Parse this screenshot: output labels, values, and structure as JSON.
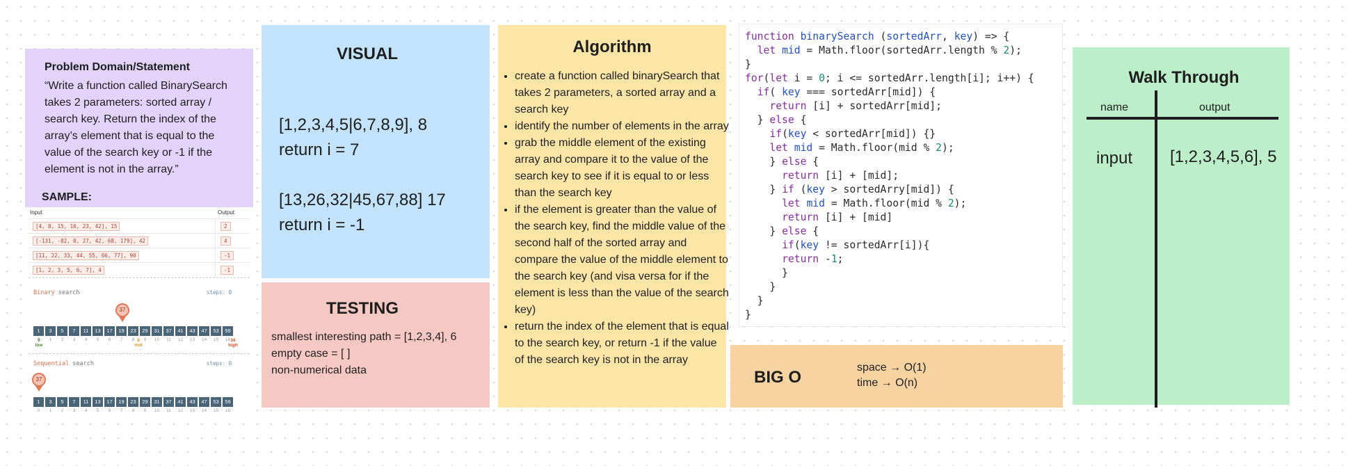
{
  "problem": {
    "title": "Problem Domain/Statement",
    "statement": "“Write a function called BinarySearch takes 2 parameters: sorted array / search key.  Return the index of the array’s element that is equal to the value of the search key or -1 if the element is not in the array.”",
    "sample_label": "SAMPLE:"
  },
  "sample": {
    "header_input": "Input",
    "header_output": "Output",
    "rows": [
      {
        "input": "[4, 8, 15, 16, 23, 42], 15",
        "output": "2"
      },
      {
        "input": "[-131, -82, 0, 27, 42, 68, 179], 42",
        "output": "4"
      },
      {
        "input": "[11, 22, 33, 44, 55, 66, 77], 90",
        "output": "-1"
      },
      {
        "input": "[1, 2, 3, 5, 6, 7], 4",
        "output": "-1"
      }
    ],
    "binary": {
      "title_highlight": "Binary",
      "title_rest": " search",
      "steps": "steps: 0",
      "pin": "37",
      "low": "low",
      "mid": "mid",
      "high": "high"
    },
    "sequential": {
      "title_highlight": "Sequential",
      "title_rest": " search",
      "steps": "steps: 0",
      "pin": "37"
    },
    "cells": [
      "1",
      "3",
      "5",
      "7",
      "11",
      "13",
      "17",
      "19",
      "23",
      "29",
      "31",
      "37",
      "41",
      "43",
      "47",
      "53",
      "59"
    ],
    "indices": [
      "0",
      "1",
      "2",
      "3",
      "4",
      "5",
      "6",
      "7",
      "8",
      "9",
      "10",
      "11",
      "12",
      "13",
      "14",
      "15",
      "16"
    ]
  },
  "visual": {
    "title": "VISUAL",
    "line1": "[1,2,3,4,5|6,7,8,9], 8",
    "line2": "return i = 7",
    "line3": "[13,26,32|45,67,88] 17",
    "line4": "return i = -1"
  },
  "testing": {
    "title": "TESTING",
    "line1": "smallest interesting path = [1,2,3,4], 6",
    "line2": "empty case = [ ]",
    "line3": "non-numerical data"
  },
  "algorithm": {
    "title": "Algorithm",
    "steps": [
      "create a function called binarySearch that takes 2 parameters, a sorted array and a search key",
      "identify the number of elements in the array",
      "grab the middle element of the existing array and compare it to the value of the search key to see if it is equal to or less than the search key",
      "if the element is greater than the value of the search key, find the middle value of the second half of the sorted array and compare the value of the middle element to the search key (and visa versa for if the element is less than the value of the search key)",
      "return the index of the element that is equal to the search key, or return -1 if the value of the search key is not in the array"
    ]
  },
  "code": {
    "lines": [
      "function binarySearch (sortedArr, key) => {",
      "  let mid = Math.floor(sortedArr.length % 2);",
      "}",
      "for(let i = 0; i <= sortedArr.length[i]; i++) {",
      "  if( key === sortedArr[mid]) {",
      "    return [i] + sortedArr[mid];",
      "  } else {",
      "    if(key < sortedArr[mid]) {}",
      "    let mid = Math.floor(mid % 2);",
      "    } else {",
      "      return [i] + [mid];",
      "    } if (key > sortedArry[mid]) {",
      "      let mid = Math.floor(mid % 2);",
      "      return [i] + [mid]",
      "    } else {",
      "      if(key != sortedArr[i]){",
      "      return -1;",
      "      }",
      "    }",
      "  }",
      "}"
    ]
  },
  "bigo": {
    "title": "BIG O",
    "space": "space → O(1)",
    "time": "time → O(n)"
  },
  "walk": {
    "title": "Walk Through",
    "col_name": "name",
    "col_output": "output",
    "input_label": "input",
    "input_value": "[1,2,3,4,5,6], 5"
  }
}
